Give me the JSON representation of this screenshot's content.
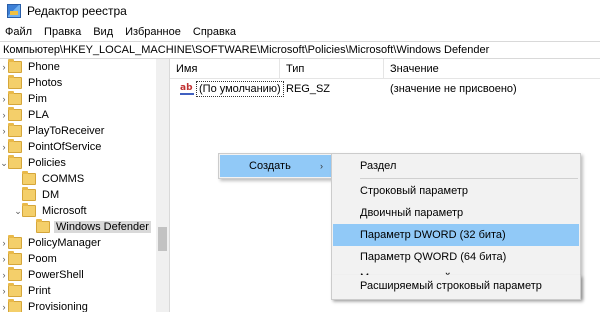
{
  "window": {
    "title": "Редактор реестра"
  },
  "menu": [
    "Файл",
    "Правка",
    "Вид",
    "Избранное",
    "Справка"
  ],
  "address": "Компьютер\\HKEY_LOCAL_MACHINE\\SOFTWARE\\Microsoft\\Policies\\Microsoft\\Windows Defender",
  "tree": {
    "items": [
      {
        "label": "Phone",
        "expander": "›"
      },
      {
        "label": "Photos",
        "expander": ""
      },
      {
        "label": "Pim",
        "expander": "›"
      },
      {
        "label": "PLA",
        "expander": "›"
      },
      {
        "label": "PlayToReceiver",
        "expander": "›"
      },
      {
        "label": "PointOfService",
        "expander": "›"
      },
      {
        "label": "Policies",
        "expander": "⌄"
      },
      {
        "label": "COMMS",
        "expander": ""
      },
      {
        "label": "DM",
        "expander": ""
      },
      {
        "label": "Microsoft",
        "expander": "⌄"
      },
      {
        "label": "Windows Defender",
        "expander": ""
      },
      {
        "label": "PolicyManager",
        "expander": "›"
      },
      {
        "label": "Poom",
        "expander": "›"
      },
      {
        "label": "PowerShell",
        "expander": "›"
      },
      {
        "label": "Print",
        "expander": "›"
      },
      {
        "label": "Provisioning",
        "expander": "›"
      }
    ]
  },
  "list": {
    "columns": [
      "Имя",
      "Тип",
      "Значение"
    ],
    "rows": [
      {
        "icon": "ab",
        "name": "(По умолчанию)",
        "type": "REG_SZ",
        "value": "(значение не присвоено)"
      }
    ]
  },
  "context_menu": {
    "item": "Создать",
    "arrow": "›"
  },
  "submenu": {
    "items": [
      "Раздел",
      "Строковый параметр",
      "Двоичный параметр",
      "Параметр DWORD (32 бита)",
      "Параметр QWORD (64 бита)",
      "Мультистроковый параметр",
      "Расширяемый строковый параметр"
    ],
    "highlighted": "Параметр DWORD (32 бита)"
  },
  "colors": {
    "highlight": "#91c9f7",
    "menu_bg": "#f2f2f2",
    "tree_selected": "#d9d9d9"
  }
}
